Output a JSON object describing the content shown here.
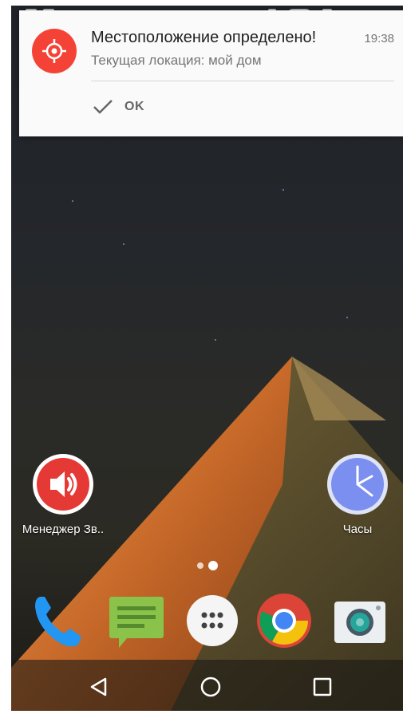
{
  "notification": {
    "title": "Местоположение определено!",
    "time": "19:38",
    "text": "Текущая локация: мой дом",
    "action_label": "OK",
    "icon": "location-target-icon",
    "accent_color": "#f44336"
  },
  "home": {
    "apps": [
      {
        "label": "Менеджер Зв..",
        "icon": "volume-icon"
      },
      {
        "label": "Часы",
        "icon": "clock-icon"
      }
    ]
  },
  "dock": [
    {
      "icon": "phone-icon"
    },
    {
      "icon": "messages-icon"
    },
    {
      "icon": "app-drawer-icon"
    },
    {
      "icon": "chrome-icon"
    },
    {
      "icon": "camera-icon"
    }
  ],
  "navbar": [
    "back-icon",
    "home-icon",
    "recents-icon"
  ]
}
